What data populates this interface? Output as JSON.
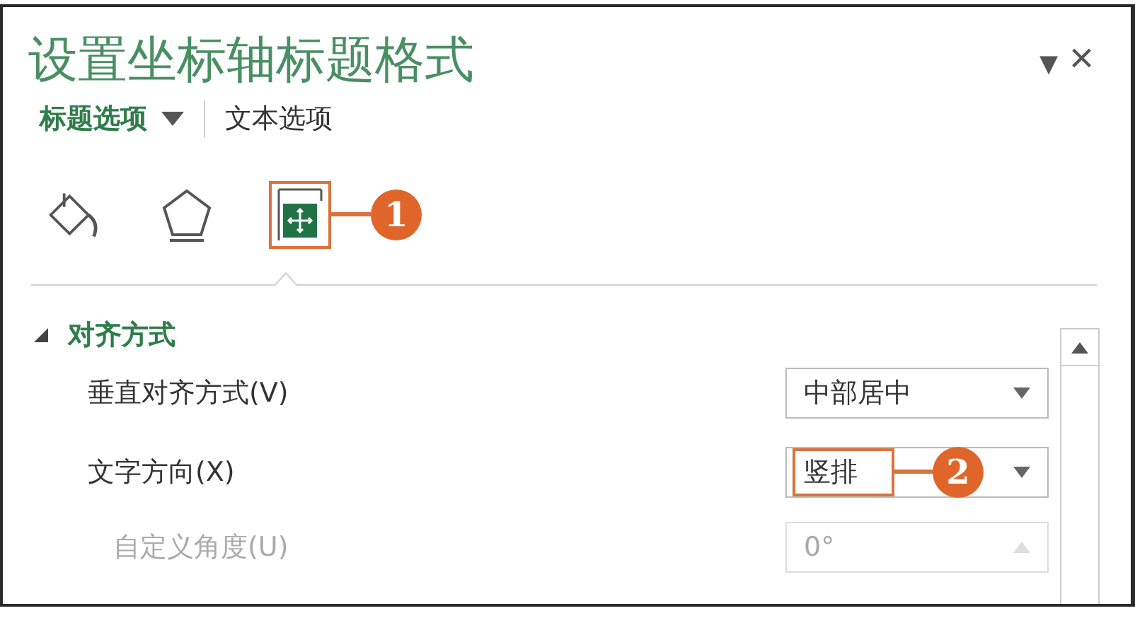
{
  "pane": {
    "title": "设置坐标轴标题格式",
    "menu_icon": "▾",
    "close_icon": "×"
  },
  "tabs": [
    {
      "label": "标题选项",
      "selected": true,
      "has_dropdown": true
    },
    {
      "label": "文本选项",
      "selected": false,
      "has_dropdown": false
    }
  ],
  "category_icons": [
    {
      "kind": "fill",
      "selected": false
    },
    {
      "kind": "effects",
      "selected": false
    },
    {
      "kind": "size",
      "selected": true,
      "callout": "1"
    }
  ],
  "section": {
    "title": "对齐方式",
    "expanded": true,
    "rows": [
      {
        "kind": "dropdown",
        "label": "垂直对齐方式(V)",
        "value": "中部居中",
        "disabled": false
      },
      {
        "kind": "dropdown",
        "label": "文字方向(X)",
        "value": "竖排",
        "disabled": false,
        "callout": "2"
      },
      {
        "kind": "spinner",
        "label": "自定义角度(U)",
        "value": "0°",
        "disabled": true
      }
    ]
  }
}
